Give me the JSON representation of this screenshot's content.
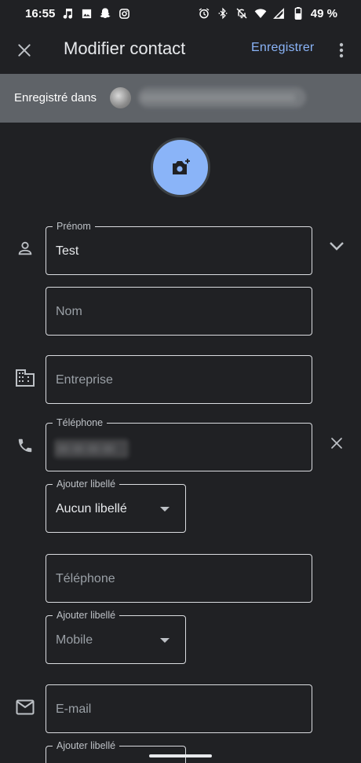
{
  "status_bar": {
    "time": "16:55",
    "battery": "49 %",
    "left_icons": [
      "music-note-icon",
      "image-icon",
      "snapchat-icon",
      "instagram-icon"
    ],
    "right_icons": [
      "alarm-icon",
      "bluetooth-icon",
      "bell-off-icon",
      "wifi-icon",
      "signal-icon",
      "battery-icon"
    ]
  },
  "toolbar": {
    "title": "Modifier contact",
    "save_label": "Enregistrer",
    "close_icon": "close-icon",
    "more_icon": "more-vert-icon"
  },
  "account": {
    "label": "Enregistré dans",
    "email": "xxxxxxxxxxxxxxxxxxxxxxxxxxxx"
  },
  "form": {
    "first_name": {
      "label": "Prénom",
      "value": "Test"
    },
    "last_name": {
      "placeholder": "Nom"
    },
    "company": {
      "placeholder": "Entreprise"
    },
    "phone": {
      "label": "Téléphone",
      "value": "xx xx xx xx"
    },
    "phone_label_select": {
      "label": "Ajouter libellé",
      "value": "Aucun libellé"
    },
    "phone2": {
      "placeholder": "Téléphone"
    },
    "phone2_label_select": {
      "label": "Ajouter libellé",
      "value": "Mobile"
    },
    "email": {
      "placeholder": "E-mail"
    },
    "email_label_select": {
      "label": "Ajouter libellé"
    }
  },
  "colors": {
    "background": "#202124",
    "accent": "#8ab4f8",
    "account_bar": "#5f6368"
  }
}
